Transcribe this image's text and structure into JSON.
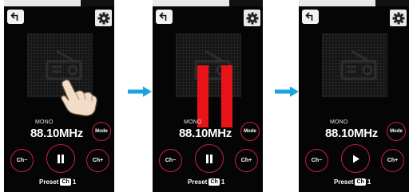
{
  "colors": {
    "accent": "#c4203f",
    "arrow": "#1aa3dd",
    "pause_bars": "#e8141a",
    "screen": "#050505"
  },
  "screens": [
    {
      "back_icon": "back-arrow-icon",
      "settings_icon": "gear-icon",
      "mono": "MONO",
      "frequency": "88.10MHz",
      "mode": "Mode",
      "ch_minus": "Ch−",
      "ch_plus": "Ch+",
      "play_state_icon": "pause-icon",
      "preset_label": "Preset",
      "preset_badge": "Ch",
      "preset_number": "1",
      "overlay": "tap-hand"
    },
    {
      "back_icon": "back-arrow-icon",
      "settings_icon": "gear-icon",
      "mono": "MONO",
      "frequency": "88.10MHz",
      "mode": "Mode",
      "ch_minus": "Ch−",
      "ch_plus": "Ch+",
      "play_state_icon": "pause-icon",
      "preset_label": "Preset",
      "preset_badge": "Ch",
      "preset_number": "1",
      "overlay": "pause-bars"
    },
    {
      "back_icon": "back-arrow-icon",
      "settings_icon": "gear-icon",
      "mono": "MONO",
      "frequency": "88.10MHz",
      "mode": "Mode",
      "ch_minus": "Ch−",
      "ch_plus": "Ch+",
      "play_state_icon": "play-icon",
      "preset_label": "Preset",
      "preset_badge": "Ch",
      "preset_number": "1",
      "overlay": "none"
    }
  ]
}
